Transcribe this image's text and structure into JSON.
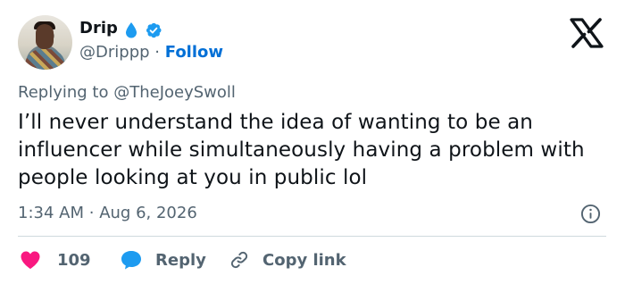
{
  "author": {
    "display_name": "Drip",
    "handle": "@Drippp",
    "separator": "·",
    "follow_label": "Follow"
  },
  "reply": {
    "prefix": "Replying to",
    "handle": "@TheJoeySwoll"
  },
  "tweet": {
    "text": "I’ll never understand the idea of wanting to be an influencer while simultaneously having a problem with people looking at you in public lol"
  },
  "meta": {
    "time": "1:34 AM",
    "separator": "·",
    "date": "Aug 6, 2026"
  },
  "actions": {
    "like_count": "109",
    "reply_label": "Reply",
    "copy_label": "Copy link"
  },
  "colors": {
    "like": "#f91880",
    "reply": "#1d9bf0",
    "link": "#006fd6",
    "verified": "#1d9bf0",
    "drop": "#1d9bf0",
    "secondary_text": "#536471"
  },
  "icons": [
    "drop-icon",
    "verified-icon",
    "x-logo",
    "info-icon",
    "heart-icon",
    "reply-bubble-icon",
    "link-icon"
  ]
}
